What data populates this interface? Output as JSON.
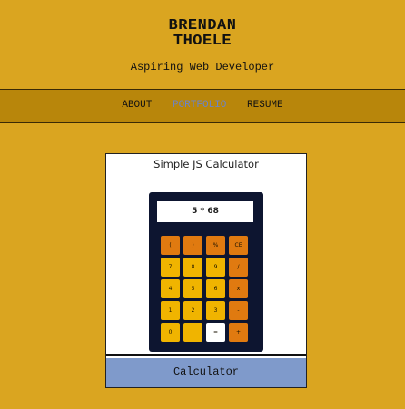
{
  "header": {
    "name_line1": "BRENDAN",
    "name_line2": "THOELE",
    "tagline": "Aspiring Web Developer"
  },
  "nav": {
    "items": [
      {
        "label": "ABOUT",
        "active": false
      },
      {
        "label": "PORTFOLIO",
        "active": true
      },
      {
        "label": "RESUME",
        "active": false
      }
    ]
  },
  "portfolio_card": {
    "screenshot_title": "Simple JS Calculator",
    "display": "5 * 68",
    "keys": [
      "(",
      ")",
      "%",
      "CE",
      "7",
      "8",
      "9",
      "/",
      "4",
      "5",
      "6",
      "x",
      "1",
      "2",
      "3",
      "-",
      "0",
      ".",
      "=",
      "+"
    ],
    "caption": "Calculator"
  },
  "colors": {
    "background": "#DAA520",
    "nav_bar": "#B8860B",
    "active_link": "#6b84c9",
    "caption_bg": "#7F9ACB",
    "calc_body": "#0d1530",
    "key_number": "#F0B400",
    "key_operator": "#E07A10"
  }
}
